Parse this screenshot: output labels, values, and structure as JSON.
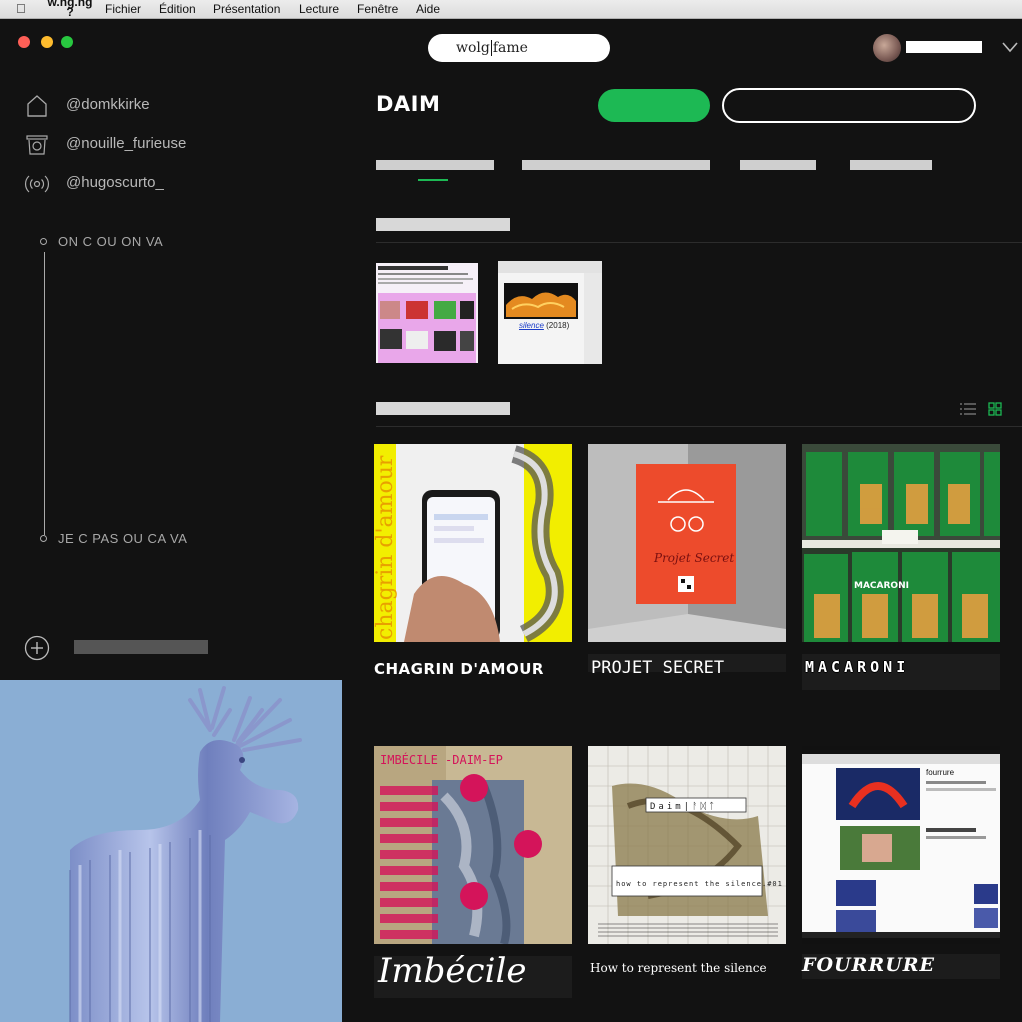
{
  "menubar": {
    "app_name": "w.ng.ng\n?",
    "items": [
      "Fichier",
      "Édition",
      "Présentation",
      "Lecture",
      "Fenêtre",
      "Aide"
    ]
  },
  "search": {
    "value_before": "wolg",
    "value_after": "fame"
  },
  "sidebar": {
    "nav": [
      {
        "label": "@domkkirke",
        "icon": "home-icon"
      },
      {
        "label": "@nouille_furieuse",
        "icon": "bin-icon"
      },
      {
        "label": "@hugoscurto_",
        "icon": "radio-icon"
      }
    ],
    "timeline": {
      "start_label": "ON C OU ON VA",
      "end_label": "JE C PAS OU CA VA"
    }
  },
  "main": {
    "logo": "DAIM",
    "recent": [
      {
        "caption": "silence",
        "year": " (2018)"
      }
    ],
    "cards": [
      {
        "title": "CHAGRIN D'AMOUR",
        "art_text": "chagrin d'amour"
      },
      {
        "title": "PROJET SECRET",
        "art_text": "Projet Secret"
      },
      {
        "title": "MACARONI",
        "art_text": "MACARONI"
      },
      {
        "title": "Imbécile",
        "art_text": "IMBÉCILE -DAIM-EP"
      },
      {
        "title": "How to represent the silence",
        "art_text": "how to represent the silence.#01"
      },
      {
        "title": "FOURRURE",
        "art_text": "fourrure"
      }
    ],
    "colors": {
      "accent": "#1db954",
      "background": "#121212"
    }
  }
}
